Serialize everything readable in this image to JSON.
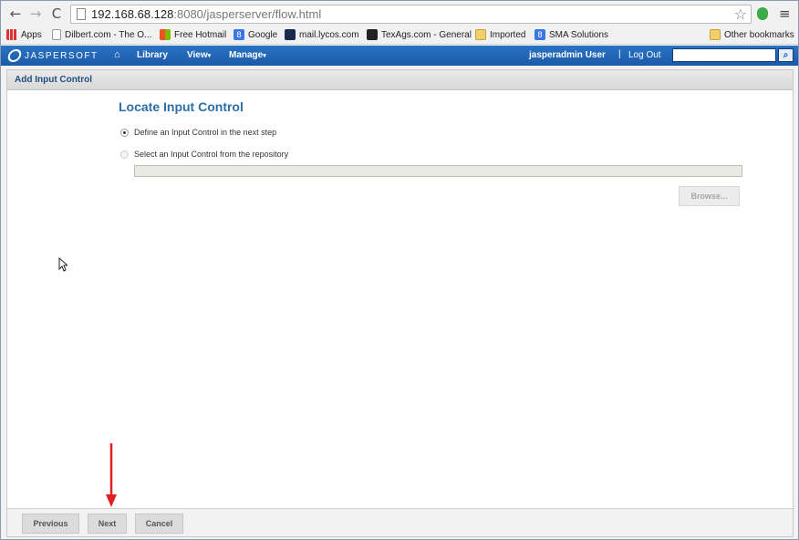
{
  "browser": {
    "url_host": "192.168.68.128",
    "url_rest": ":8080/jasperserver/flow.html"
  },
  "bookmarks": [
    {
      "label": "Apps",
      "icon": "apps-icon"
    },
    {
      "label": "Dilbert.com - The O...",
      "icon": "page-icon"
    },
    {
      "label": "Free Hotmail",
      "icon": "windows-icon"
    },
    {
      "label": "Google",
      "icon": "google-icon"
    },
    {
      "label": "mail.lycos.com",
      "icon": "lycos-icon"
    },
    {
      "label": "TexAgs.com - General",
      "icon": "texags-icon"
    },
    {
      "label": "Imported",
      "icon": "folder-icon"
    },
    {
      "label": "SMA Solutions",
      "icon": "google-icon"
    },
    {
      "label": "Other bookmarks",
      "icon": "folder-icon"
    }
  ],
  "header": {
    "brand": "JASPERSOFT",
    "nav": [
      "Library",
      "View",
      "Manage"
    ],
    "user": "jasperadmin User",
    "separator": "|",
    "logout": "Log Out"
  },
  "dialog": {
    "title": "Add Input Control",
    "section_title": "Locate Input Control",
    "options": [
      {
        "label": "Define an Input Control in the next step",
        "selected": true
      },
      {
        "label": "Select an Input Control from the repository",
        "selected": false
      }
    ],
    "repo_path_value": "",
    "browse_label": "Browse...",
    "buttons": {
      "previous": "Previous",
      "next": "Next",
      "cancel": "Cancel"
    }
  },
  "colors": {
    "header_blue": "#1b5aa8",
    "title_blue": "#2d6fa6",
    "arrow_red": "#e02020"
  }
}
